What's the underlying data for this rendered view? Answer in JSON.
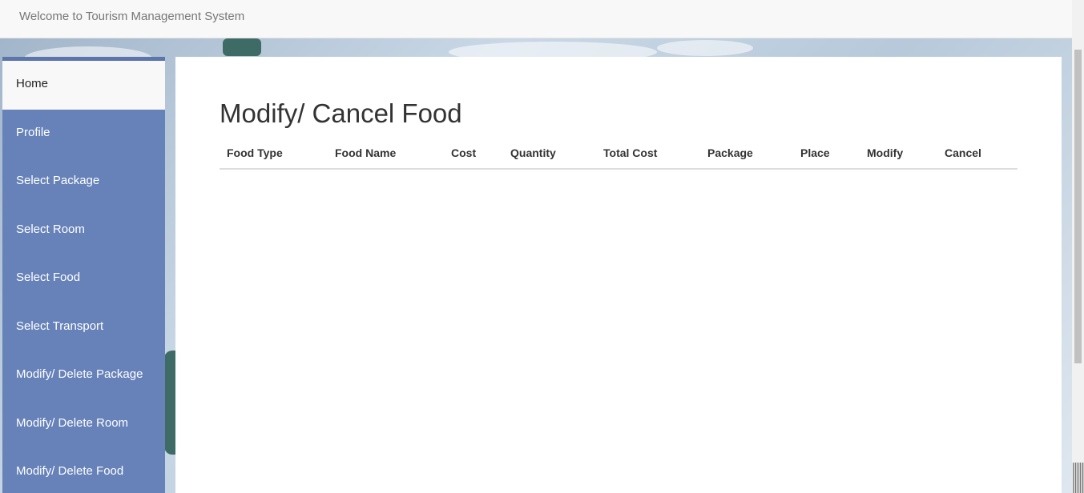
{
  "header": {
    "brand": "Welcome to Tourism Management System"
  },
  "sidebar": {
    "items": [
      {
        "label": "Home"
      },
      {
        "label": "Profile"
      },
      {
        "label": "Select Package"
      },
      {
        "label": "Select Room"
      },
      {
        "label": "Select Food"
      },
      {
        "label": "Select Transport"
      },
      {
        "label": "Modify/ Delete Package"
      },
      {
        "label": "Modify/ Delete Room"
      },
      {
        "label": "Modify/ Delete Food"
      }
    ]
  },
  "main": {
    "title": "Modify/ Cancel Food",
    "table": {
      "columns": [
        "Food Type",
        "Food Name",
        "Cost",
        "Quantity",
        "Total Cost",
        "Package",
        "Place",
        "Modify",
        "Cancel"
      ],
      "rows": []
    }
  },
  "colors": {
    "sidebar_bg": "#6682b9",
    "active_item_bg": "#f8f8f8",
    "header_bg": "#f8f8f8",
    "content_bg": "#ffffff"
  }
}
